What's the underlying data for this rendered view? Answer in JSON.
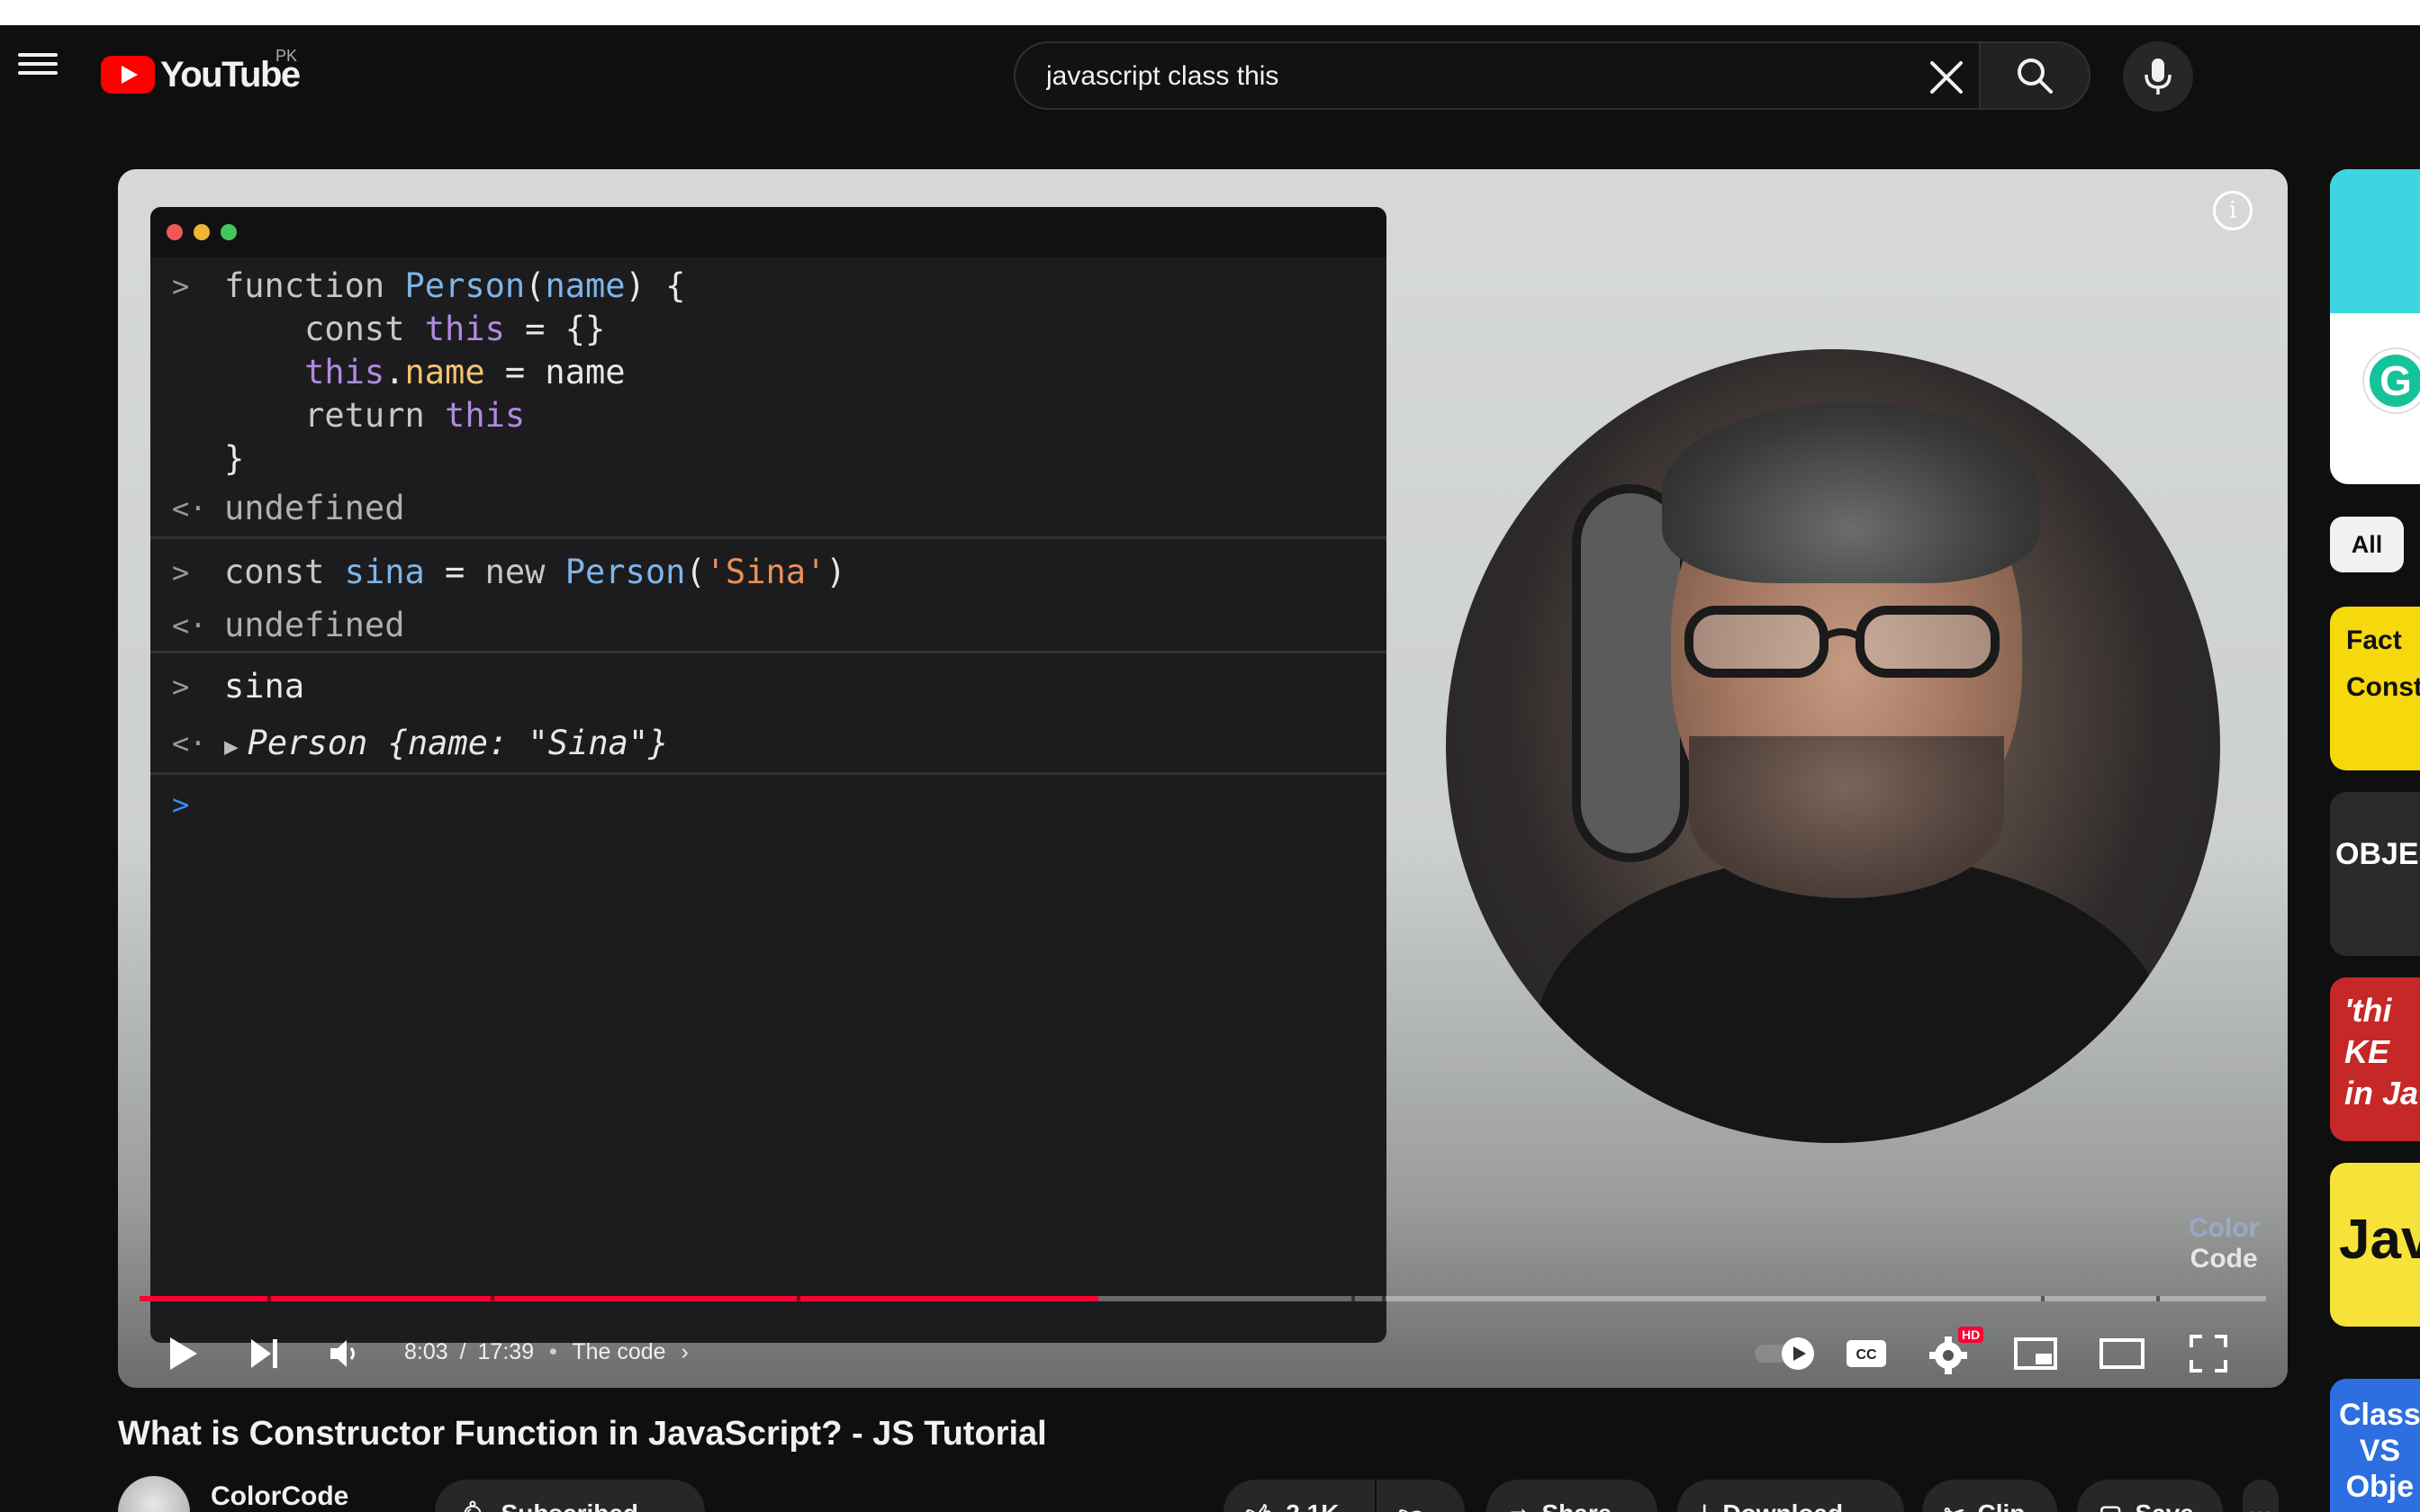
{
  "header": {
    "logo_text": "YouTube",
    "country_code": "PK",
    "search": {
      "value": "javascript class this"
    }
  },
  "player": {
    "console": {
      "entries": [
        {
          "input_lines": [
            "function Person(name) {",
            "    const this = {}",
            "    this.name = name",
            "    return this",
            "}"
          ],
          "output": "undefined"
        },
        {
          "input_lines": [
            "const sina = new Person('Sina')"
          ],
          "output": "undefined"
        },
        {
          "input_lines": [
            "sina"
          ],
          "output": "Person {name: \"Sina\"}"
        }
      ]
    },
    "watermark": {
      "line1": "Color",
      "line2": "Code"
    },
    "progress_fraction": 0.451,
    "time": {
      "current": "8:03",
      "total": "17:39",
      "separator": "/",
      "bullet": "•",
      "chapter": "The code"
    },
    "hd_badge": "HD",
    "cc_label": "CC"
  },
  "sidebar": {
    "chip_all": "All",
    "thumbnails": [
      {
        "text": "Fact\nConst",
        "bg": "#f5d90a",
        "fg": "#111111"
      },
      {
        "text": "OBJECT",
        "bg": "#2a2a2a",
        "fg": "#ffffff"
      },
      {
        "text": "'thi\nKE\nin Java",
        "bg": "#c62828",
        "fg": "#ffffff"
      },
      {
        "text": "Jav",
        "bg": "#f7e23a",
        "fg": "#111111"
      },
      {
        "text": "Class\nVS\nObje",
        "bg": "#2d6fe0",
        "fg": "#ffffff"
      }
    ]
  },
  "video": {
    "title": "What is Constructor Function in JavaScript? - JS Tutorial",
    "channel": "ColorCode",
    "subscribe_label": "Subscribed",
    "like_count": "2.1K",
    "share_label": "Share",
    "download_label": "Download",
    "clip_label": "Clip",
    "save_label": "Save"
  },
  "colors": {
    "accent_red": "#ff0033",
    "youtube_red": "#ff0000",
    "background": "#0f0f0f"
  }
}
